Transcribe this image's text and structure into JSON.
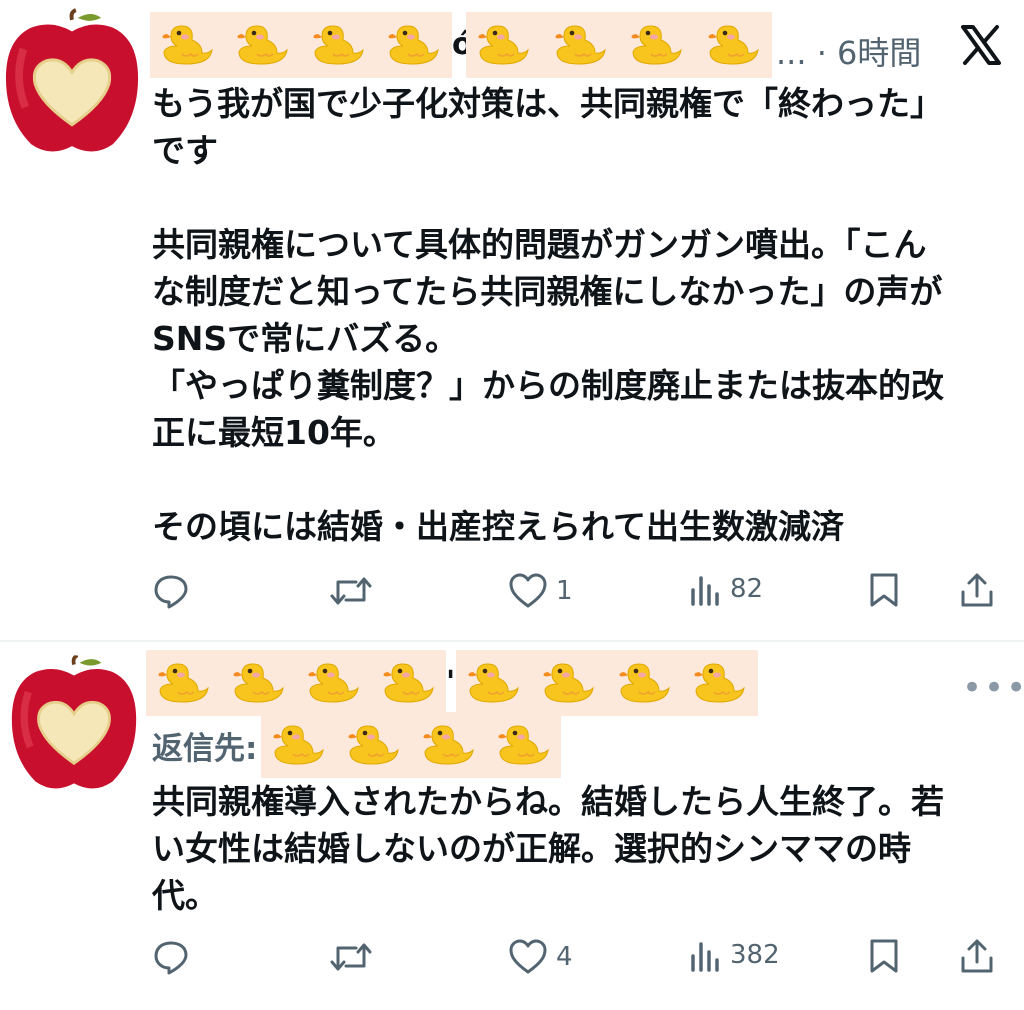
{
  "tweet1": {
    "display_name_visible_char": "ó",
    "truncation": "...",
    "separator": "·",
    "time": "6時間",
    "platform_logo": "x-logo",
    "text": "もう我が国で少子化対策は、共同親権で「終わった」\nです\n\n共同親権について具体的問題がガンガン噴出。「こん\nな制度だと知ってたら共同親権にしなかった」の声が\nSNSで常にバズる。\n「やっぱり糞制度？」からの制度廃止または抜本的改\n正に最短10年。\n\nその頃には結婚・出産控えられて出生数激減済",
    "likes": "1",
    "views": "82"
  },
  "tweet2": {
    "display_name_visible_char": "'",
    "reply_label": "返信先:",
    "text": "共同親権導入されたからね。結婚したら人生終了。若\nい女性は結婚しないのが正解。選択的シンママの時\n代。",
    "likes": "4",
    "views": "382",
    "more_icon": "•••"
  },
  "icons": {
    "avatar": "apple-heart-avatar",
    "redaction": "duck-sticker",
    "reply": "reply-icon",
    "retweet": "retweet-icon",
    "like": "heart-icon",
    "views": "views-icon",
    "bookmark": "bookmark-icon",
    "share": "share-icon"
  },
  "colors": {
    "text": "#0f1419",
    "secondary": "#536471",
    "duck_background": "#fde9dc",
    "duck": "#f7c51e",
    "apple": "#c8102e"
  }
}
